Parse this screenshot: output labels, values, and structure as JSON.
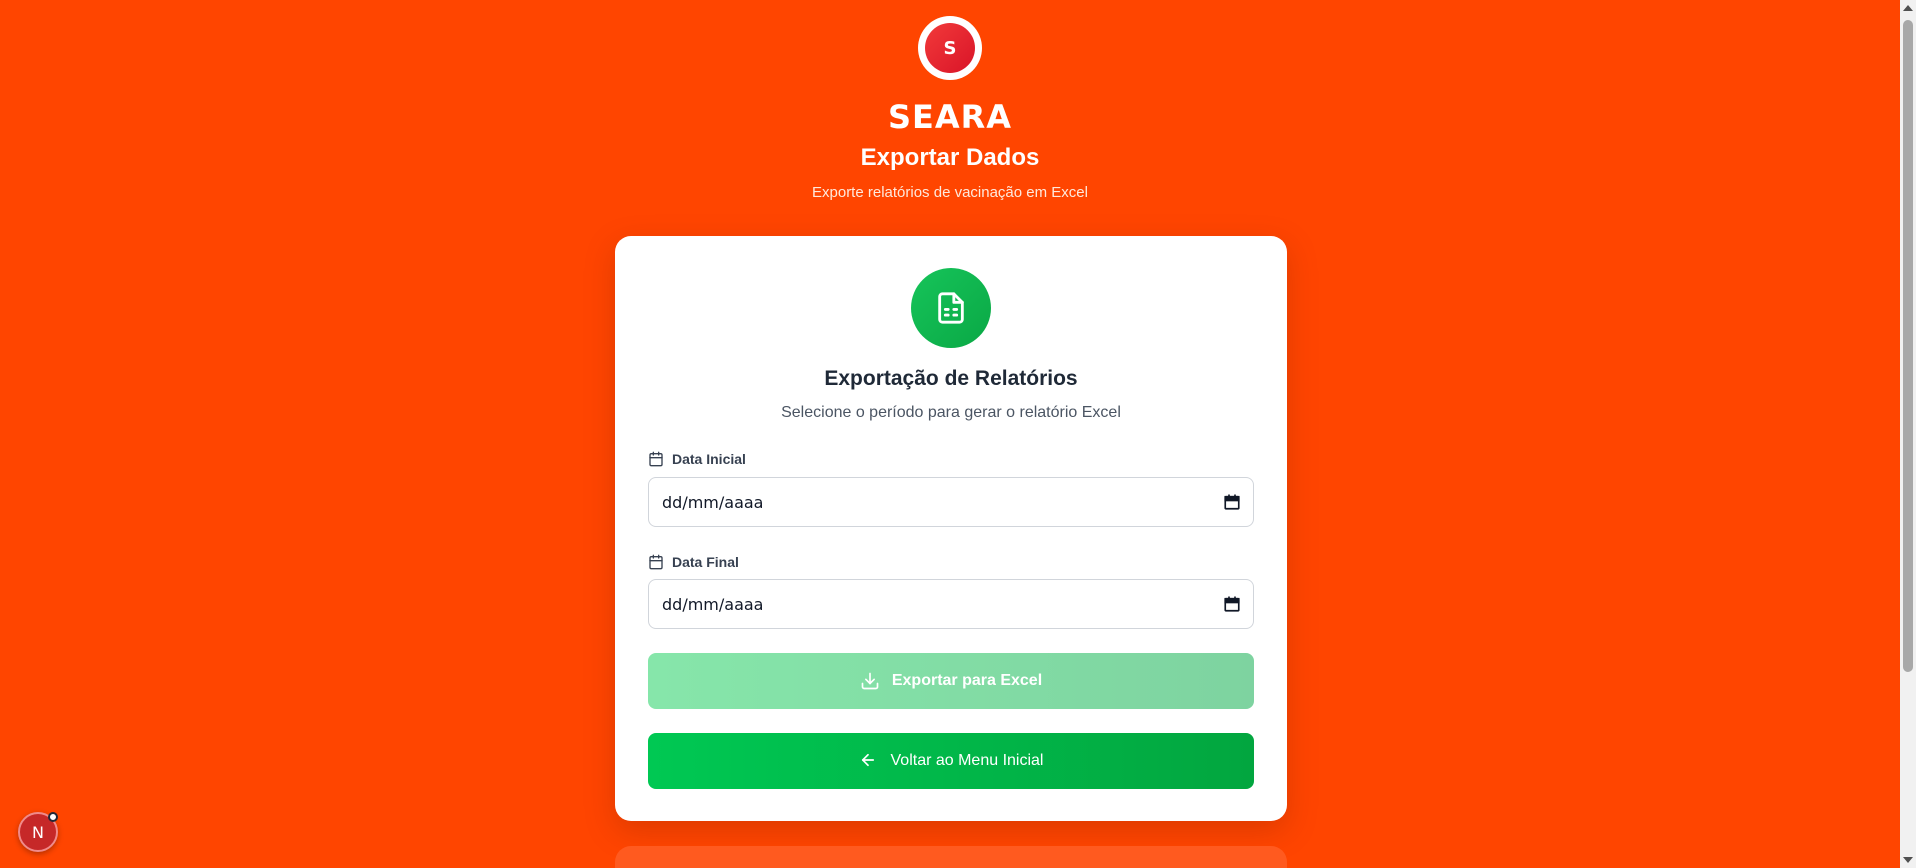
{
  "header": {
    "logo_letter": "S",
    "brand": "SEARA",
    "title": "Exportar Dados",
    "subtitle": "Exporte relatórios de vacinação em Excel"
  },
  "card": {
    "icon": "spreadsheet-file-icon",
    "title": "Exportação de Relatórios",
    "subtitle": "Selecione o período para gerar o relatório Excel",
    "start_date": {
      "label": "Data Inicial",
      "value": "dd/mm/aaaa",
      "icon": "calendar-icon"
    },
    "end_date": {
      "label": "Data Final",
      "value": "dd/mm/aaaa",
      "icon": "calendar-icon"
    },
    "export_button": {
      "label": "Exportar para Excel",
      "icon": "download-icon",
      "enabled": false
    },
    "back_button": {
      "label": "Voltar ao Menu Inicial",
      "icon": "arrow-left-icon"
    }
  },
  "dev_badge": {
    "letter": "N"
  },
  "colors": {
    "background": "#ff4500",
    "primary_green": "#00c853",
    "logo_red": "#e3202f"
  }
}
